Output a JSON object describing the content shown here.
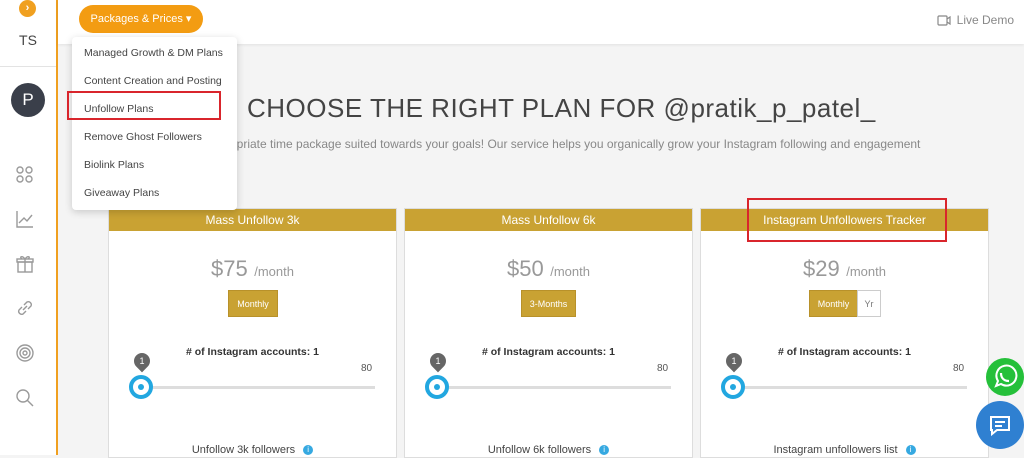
{
  "sidebar": {
    "expand_icon": "chevron-right-icon",
    "expand_glyph": "›",
    "initials": "TS",
    "avatar_letter": "P",
    "icons": [
      "grid-icon",
      "chart-icon",
      "gift-icon",
      "link-icon",
      "target-icon",
      "search-icon"
    ]
  },
  "topbar": {
    "packages_label": "Packages & Prices ▾",
    "live_demo": "Live Demo"
  },
  "dropdown": {
    "items": [
      "Managed Growth & DM Plans",
      "Content Creation and Posting",
      "Unfollow Plans",
      "Remove Ghost Followers",
      "Biolink Plans",
      "Giveaway Plans"
    ]
  },
  "main": {
    "title": "CHOOSE THE RIGHT PLAN FOR  @pratik_p_patel_",
    "subtitle": "opriate time package suited towards your goals! Our service helps you organically grow your Instagram following and engagement"
  },
  "cards": [
    {
      "title": "Mass Unfollow 3k",
      "price": "$75",
      "per": "/month",
      "period": "Monthly",
      "accounts_label": "# of Instagram accounts: 1",
      "slider_value": "1",
      "slider_max": "80",
      "feature": "Unfollow 3k followers"
    },
    {
      "title": "Mass Unfollow 6k",
      "price": "$50",
      "per": "/month",
      "period": "3-Months",
      "accounts_label": "# of Instagram accounts: 1",
      "slider_value": "1",
      "slider_max": "80",
      "feature": "Unfollow 6k followers"
    },
    {
      "title": "Instagram Unfollowers Tracker",
      "price": "$29",
      "per": "/month",
      "period": "Monthly",
      "period_alt": "Yr",
      "accounts_label": "# of Instagram accounts: 1",
      "slider_value": "1",
      "slider_max": "80",
      "feature": "Instagram unfollowers list"
    }
  ],
  "info_glyph": "i",
  "colors": {
    "accent": "#f39c12",
    "card_header": "#c9a233",
    "highlight": "#d9252c",
    "slider": "#22a7e0",
    "whatsapp": "#25c03a",
    "chat": "#2f80d1"
  }
}
